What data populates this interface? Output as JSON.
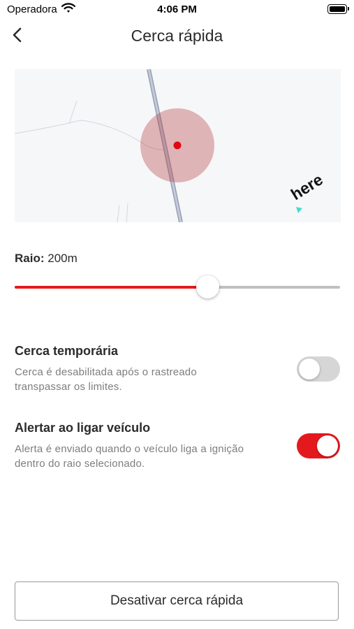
{
  "status_bar": {
    "carrier": "Operadora",
    "time": "4:06 PM"
  },
  "nav": {
    "title": "Cerca rápida",
    "back_icon": "chevron-left-icon"
  },
  "map": {
    "logo_text": "here",
    "fence_color": "#b4373c",
    "center_color": "#e30613"
  },
  "radius": {
    "label": "Raio:",
    "value": "200m",
    "slider_fraction": 0.593,
    "accent_color": "#e4191e"
  },
  "settings": [
    {
      "title": "Cerca temporária",
      "description": "Cerca é desabilitada após o rastreado transpassar os limites.",
      "enabled": false
    },
    {
      "title": "Alertar ao ligar veículo",
      "description": "Alerta é enviado quando o veículo liga a ignição dentro do raio selecionado.",
      "enabled": true
    }
  ],
  "actions": {
    "deactivate_label": "Desativar cerca rápida"
  }
}
